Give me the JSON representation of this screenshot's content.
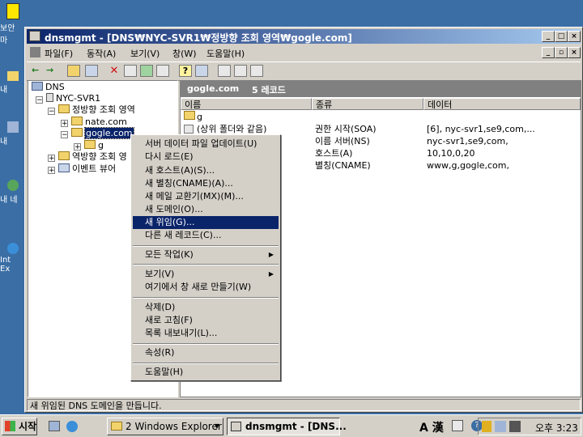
{
  "desktop": {
    "icons": [
      "보안\n마",
      "내",
      "내 ",
      "내 네",
      "Int\nEx"
    ]
  },
  "window": {
    "title": "dnsmgmt - [DNS₩NYC-SVR1₩정방향 조회 영역₩gogle.com]",
    "controls": [
      "_",
      "□",
      "×"
    ]
  },
  "menubar": [
    "파일(F)",
    "동작(A)",
    "보기(V)",
    "창(W)",
    "도움말(H)"
  ],
  "inner_controls": [
    "_",
    "▫",
    "×"
  ],
  "tree": {
    "root": "DNS",
    "server": "NYC-SVR1",
    "forward": "정방향 조회 영역",
    "zone1": "nate.com",
    "zone2": "gogle.com",
    "sub": "g",
    "reverse": "역방향 조회 영",
    "events": "이벤트 뷰어"
  },
  "right": {
    "header_name": "gogle.com",
    "header_count": "5 레코드",
    "columns": [
      "이름",
      "종류",
      "데이터"
    ],
    "rows": [
      {
        "name": "g",
        "type": "",
        "data": ""
      },
      {
        "name": "(상위 폴더와 같음)",
        "type": "권한 시작(SOA)",
        "data": "[6], nyc-svr1,se9,com,..."
      },
      {
        "name": "",
        "type": "이름 서버(NS)",
        "data": "nyc-svr1,se9,com,"
      },
      {
        "name": "",
        "type": "호스트(A)",
        "data": "10,10,0,20"
      },
      {
        "name": "",
        "type": "별칭(CNAME)",
        "data": "www,g,gogle,com,"
      }
    ]
  },
  "context_menu": {
    "group1": [
      "서버 데이터 파일 업데이트(U)",
      "다시 로드(E)",
      "새 호스트(A)(S)...",
      "새 별칭(CNAME)(A)...",
      "새 메일 교환기(MX)(M)...",
      "새 도메인(O)...",
      "새 위임(G)...",
      "다른 새 레코드(C)..."
    ],
    "group2": [
      "모든 작업(K)"
    ],
    "group3": [
      "보기(V)",
      "여기에서 창 새로 만들기(W)"
    ],
    "group4": [
      "삭제(D)",
      "새로 고침(F)",
      "목록 내보내기(L)..."
    ],
    "group5": [
      "속성(R)"
    ],
    "group6": [
      "도움말(H)"
    ],
    "selected": "새 위임(G)..."
  },
  "status": "새 위임된 DNS 도메인을 만듭니다.",
  "taskbar": {
    "start": "시작",
    "explorer": "2 Windows Explorer",
    "dnsmgmt": "dnsmgmt - [DNS...",
    "ime": "A 漢",
    "clock": "오후 3:23"
  },
  "colors": {
    "title_left": "#0a246a",
    "title_right": "#a6caf0",
    "desktop": "#3a6ea5",
    "selection": "#0a246a"
  }
}
